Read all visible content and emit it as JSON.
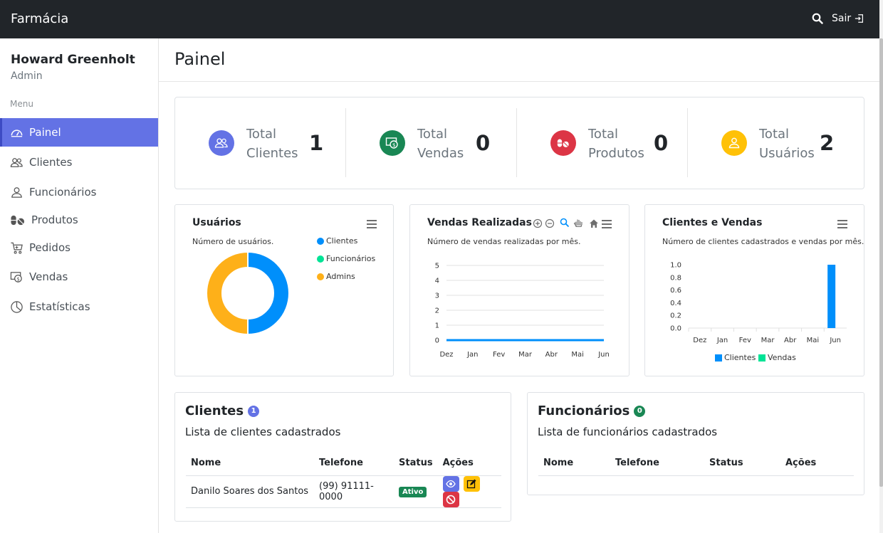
{
  "topbar": {
    "brand": "Farmácia",
    "logout_label": "Sair",
    "search_icon": "search-icon",
    "logout_icon": "sign-out-icon"
  },
  "sidebar": {
    "user_name": "Howard Greenholt",
    "user_role": "Admin",
    "menu_label": "Menu",
    "items": [
      {
        "label": "Painel",
        "icon": "dashboard-icon",
        "active": true
      },
      {
        "label": "Clientes",
        "icon": "users-icon"
      },
      {
        "label": "Funcionários",
        "icon": "user-icon"
      },
      {
        "label": "Produtos",
        "icon": "pills-icon"
      },
      {
        "label": "Pedidos",
        "icon": "cart-icon"
      },
      {
        "label": "Vendas",
        "icon": "cash-icon"
      },
      {
        "label": "Estatísticas",
        "icon": "pie-chart-icon"
      }
    ]
  },
  "page": {
    "title": "Painel"
  },
  "stats": [
    {
      "label1": "Total",
      "label2": "Clientes",
      "value": "1",
      "color": "#6372e5"
    },
    {
      "label1": "Total",
      "label2": "Vendas",
      "value": "0",
      "color": "#198754"
    },
    {
      "label1": "Total",
      "label2": "Produtos",
      "value": "0",
      "color": "#dc3545"
    },
    {
      "label1": "Total",
      "label2": "Usuários",
      "value": "2",
      "color": "#ffc107"
    }
  ],
  "chart_data": [
    {
      "type": "pie",
      "title": "Usuários",
      "subtitle": "Número de usuários.",
      "labels": [
        "Clientes",
        "Funcionários",
        "Admins"
      ],
      "values": [
        1,
        0,
        1
      ],
      "colors": [
        "#008ffb",
        "#00e396",
        "#feb019"
      ]
    },
    {
      "type": "line",
      "title": "Vendas Realizadas",
      "subtitle": "Número de vendas realizadas por mês.",
      "categories": [
        "Dez",
        "Jan",
        "Fev",
        "Mar",
        "Abr",
        "Mai",
        "Jun"
      ],
      "series": [
        {
          "values": [
            0,
            0,
            0,
            0,
            0,
            0,
            0
          ]
        }
      ],
      "ylim": [
        0,
        5
      ],
      "yticks": [
        "5",
        "4",
        "3",
        "2",
        "1",
        "0"
      ],
      "color": "#008ffb"
    },
    {
      "type": "bar",
      "title": "Clientes e Vendas",
      "subtitle": "Número de clientes cadastrados e vendas por mês.",
      "categories": [
        "Dez",
        "Jan",
        "Fev",
        "Mar",
        "Abr",
        "Mai",
        "Jun"
      ],
      "series": [
        {
          "name": "Clientes",
          "values": [
            0,
            0,
            0,
            0,
            0,
            0,
            1
          ],
          "color": "#008ffb"
        },
        {
          "name": "Vendas",
          "values": [
            0,
            0,
            0,
            0,
            0,
            0,
            0
          ],
          "color": "#00e396"
        }
      ],
      "ylim": [
        0,
        1
      ],
      "yticks": [
        "1.0",
        "0.8",
        "0.6",
        "0.4",
        "0.2",
        "0.0"
      ]
    }
  ],
  "clientes": {
    "title": "Clientes",
    "count": "1",
    "subtitle": "Lista de clientes cadastrados",
    "headers": [
      "Nome",
      "Telefone",
      "Status",
      "Ações"
    ],
    "rows": [
      {
        "nome": "Danilo Soares dos Santos",
        "telefone": "(99) 91111-0000",
        "status": "Ativo"
      }
    ]
  },
  "funcionarios": {
    "title": "Funcionários",
    "count": "0",
    "subtitle": "Lista de funcionários cadastrados",
    "headers": [
      "Nome",
      "Telefone",
      "Status",
      "Ações"
    ]
  }
}
